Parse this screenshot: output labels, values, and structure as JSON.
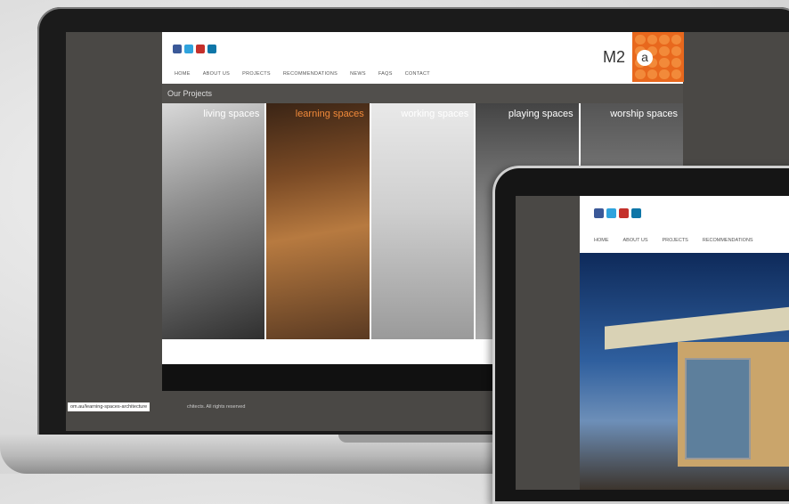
{
  "laptop_site": {
    "nav": [
      "HOME",
      "ABOUT US",
      "PROJECTS",
      "RECOMMENDATIONS",
      "NEWS",
      "FAQS",
      "CONTACT"
    ],
    "logo": "M2",
    "logo_letter": "a",
    "section_title": "Our Projects",
    "panels": [
      "living spaces",
      "learning spaces",
      "working spaces",
      "playing spaces",
      "worship spaces"
    ],
    "status_url": "om.au/learning-spaces-architecture",
    "copyright": "chitects. All rights reserved"
  },
  "tablet_site": {
    "nav": [
      "HOME",
      "ABOUT US",
      "PROJECTS",
      "RECOMMENDATIONS"
    ]
  },
  "colors": {
    "brand_orange": "#e8681d",
    "page_bg": "#4a4845"
  },
  "icons": [
    "facebook-icon",
    "twitter-icon",
    "youtube-icon",
    "linkedin-icon"
  ]
}
